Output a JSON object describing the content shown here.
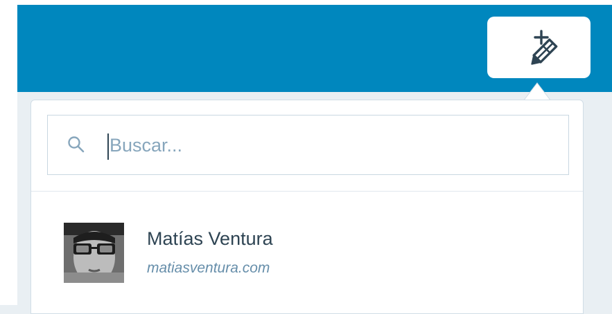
{
  "masterbar": {
    "write_button_icon": "write-post-icon"
  },
  "site_selector": {
    "search": {
      "placeholder": "Buscar...",
      "value": "",
      "icon": "search-icon"
    },
    "sites": [
      {
        "title": "Matías Ventura",
        "domain": "matiasventura.com",
        "avatar": "site-avatar"
      }
    ]
  },
  "colors": {
    "masterbar_blue": "#0087be",
    "text_dark": "#2e4453",
    "text_muted": "#668eaa",
    "placeholder": "#87a6bc",
    "border": "#c8d7e1",
    "background": "#e9eff3"
  }
}
